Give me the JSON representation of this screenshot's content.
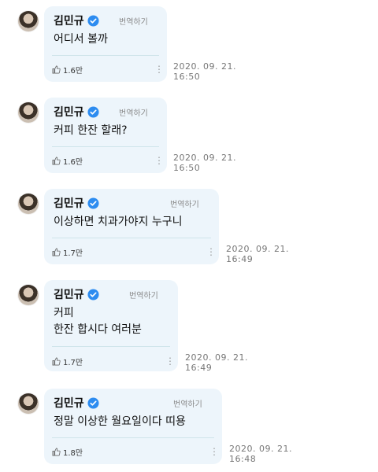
{
  "messages": [
    {
      "name": "김민규",
      "translate_label": "번역하기",
      "text": "어디서 볼까",
      "likes": "1.6만",
      "timestamp": "2020. 09. 21.\n16:50"
    },
    {
      "name": "김민규",
      "translate_label": "번역하기",
      "text": "커피 한잔 할래?",
      "likes": "1.6만",
      "timestamp": "2020. 09. 21.\n16:50"
    },
    {
      "name": "김민규",
      "translate_label": "번역하기",
      "text": "이상하면 치과가야지 누구니",
      "likes": "1.7만",
      "timestamp": "2020. 09. 21.\n16:49"
    },
    {
      "name": "김민규",
      "translate_label": "번역하기",
      "text": "커피\n한잔 합시다 여러분",
      "likes": "1.7만",
      "timestamp": "2020. 09. 21.\n16:49"
    },
    {
      "name": "김민규",
      "translate_label": "번역하기",
      "text": "정말 이상한 월요일이다 띠용",
      "likes": "1.8만",
      "timestamp": "2020. 09. 21.\n16:48"
    }
  ],
  "icons": {
    "verified": "verified-badge-icon",
    "like": "thumbs-up-icon",
    "more": "more-vertical-icon"
  },
  "colors": {
    "bubble": "#edf5fb",
    "verified": "#2d8cf0"
  }
}
